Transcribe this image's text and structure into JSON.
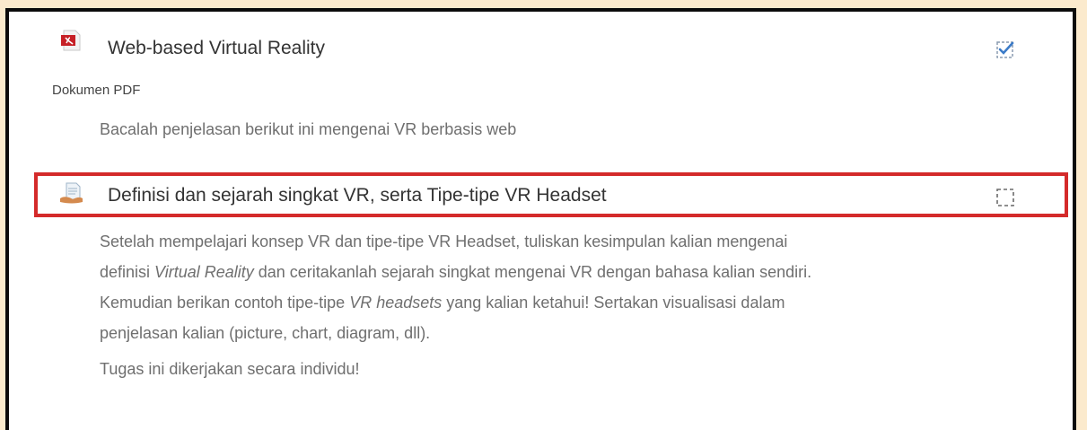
{
  "activity1": {
    "icon": "pdf-file-icon",
    "title": "Web-based Virtual Reality",
    "type": "Dokumen PDF",
    "description": "Bacalah penjelasan berikut ini mengenai VR berbasis web",
    "completion": "checked",
    "completion_icon": "completion-checked-icon"
  },
  "activity2": {
    "icon": "assignment-icon",
    "title": "Definisi dan sejarah singkat VR, serta Tipe-tipe VR Headset",
    "completion": "unchecked",
    "completion_icon": "completion-empty-icon",
    "desc": {
      "p1_a": "Setelah mempelajari konsep VR dan tipe-tipe VR Headset, tuliskan kesimpulan kalian mengenai",
      "p1_b": "definisi ",
      "p1_c": "Virtual Reality",
      "p1_d": " dan ceritakanlah sejarah singkat mengenai VR dengan bahasa kalian sendiri.",
      "p1_e": "Kemudian berikan contoh tipe-tipe ",
      "p1_f": "VR headsets",
      "p1_g": " yang kalian ketahui! Sertakan visualisasi dalam",
      "p1_h": "penjelasan kalian (picture, chart, diagram, dll).",
      "p2": "Tugas ini dikerjakan secara individu!"
    }
  },
  "colors": {
    "page_bg": "#fbeacd",
    "highlight": "#d42a2a",
    "check_blue": "#3b7bc8"
  }
}
